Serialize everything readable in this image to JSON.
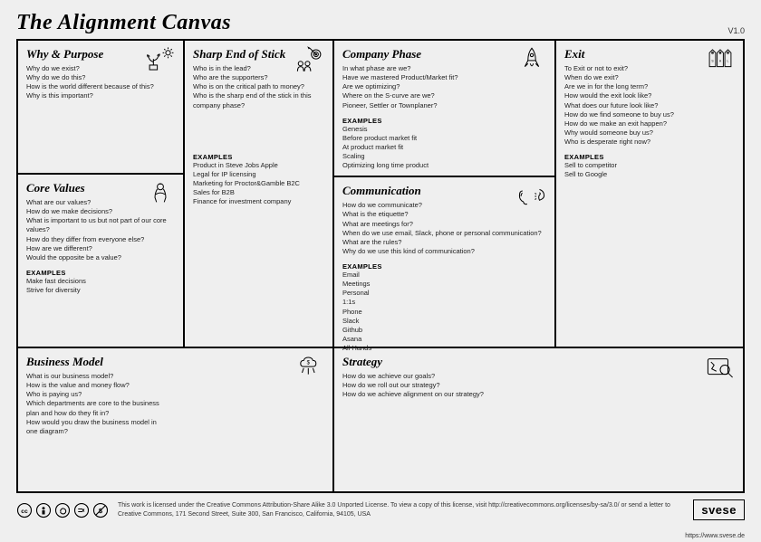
{
  "title": "The Alignment Canvas",
  "version": "V1.0",
  "sections": {
    "why": {
      "title": "Why & Purpose",
      "questions": [
        "Why do we exist?",
        "Why do we do this?",
        "How is the world different because of this?",
        "Why is this important?"
      ]
    },
    "values": {
      "title": "Core Values",
      "questions": [
        "What are our values?",
        "How do we make decisions?",
        "What is important to us but not part of our core values?",
        "How do they differ from everyone else?",
        "How are we different?",
        "Would the opposite be a value?"
      ],
      "examples_h": "EXAMPLES",
      "examples": [
        "Make fast decisions",
        "Strive for diversity"
      ]
    },
    "sharp": {
      "title": "Sharp End of Stick",
      "questions": [
        "Who is in the lead?",
        "Who are the supporters?",
        "Who is on the critical path to money?",
        "Who is the sharp end of the stick in this company phase?"
      ],
      "examples_h": "EXAMPLES",
      "examples": [
        "Product in Steve Jobs Apple",
        "Legal for IP licensing",
        "Marketing for Proctor&Gamble B2C",
        "Sales for B2B",
        "Finance for investment company"
      ]
    },
    "phase": {
      "title": "Company Phase",
      "questions": [
        "In what phase are we?",
        "Have we mastered Product/Market fit?",
        "Are we optimizing?",
        "Where on the S-curve are we?",
        "Pioneer, Settler or Townplaner?"
      ],
      "examples_h": "EXAMPLES",
      "examples": [
        "Genesis",
        "Before product market fit",
        "At product market fit",
        "Scaling",
        "Optimizing long time product"
      ]
    },
    "comm": {
      "title": "Communication",
      "questions": [
        "How do we communicate?",
        "What is the etiquette?",
        "What are meetings for?",
        "When do we use email, Slack, phone or personal communication?",
        "What are the rules?",
        "Why do we use this kind of communication?"
      ],
      "examples_h": "EXAMPLES",
      "examples": [
        "Email",
        "Meetings",
        "Personal",
        "1:1s",
        "Phone",
        "Slack",
        "Github",
        "Asana",
        "All Hands"
      ]
    },
    "exit": {
      "title": "Exit",
      "questions": [
        "To Exit or not to exit?",
        "When do we exit?",
        "Are we in for the long term?",
        "How would the exit look like?",
        "What does our future look like?",
        "How do we find someone to buy us?",
        "How do we make an exit happen?",
        "Why would someone buy us?",
        "Who is desperate right now?"
      ],
      "examples_h": "EXAMPLES",
      "examples": [
        "Sell to competitor",
        "Sell to Google"
      ]
    },
    "bm": {
      "title": "Business Model",
      "questions": [
        "What is our business model?",
        "How is the value and money flow?",
        "Who is paying us?",
        "Which departments are core to the business plan and how do they fit in?",
        "How would you draw the business model in one diagram?"
      ]
    },
    "strategy": {
      "title": "Strategy",
      "questions": [
        "How do we achieve our goals?",
        "How do we roll out our strategy?",
        "How do we achieve alignment on our strategy?"
      ]
    }
  },
  "footer": {
    "license": "This work is licensed under the Creative Commons Attribution-Share Alike 3.0 Unported License. To view a copy of this license, visit http://creativecommons.org/licenses/by-sa/3.0/ or send a letter to Creative Commons, 171 Second Street, Suite 300, San Francisco, California, 94105, USA",
    "logo": "svese",
    "url": "https://www.svese.de"
  }
}
